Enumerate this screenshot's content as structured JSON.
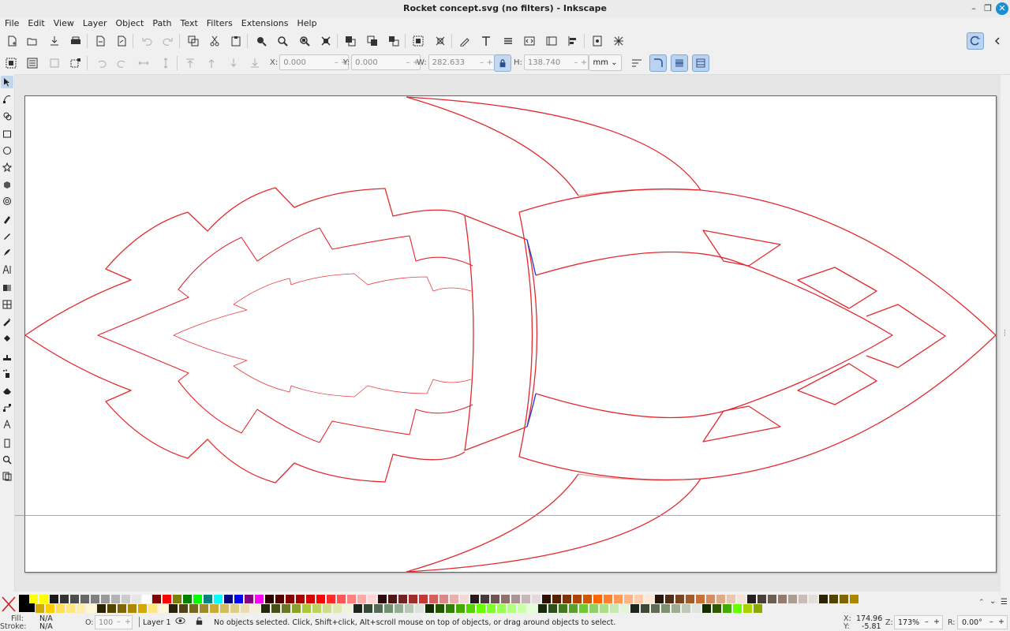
{
  "window": {
    "title": "Rocket concept.svg (no filters) - Inkscape"
  },
  "menu": [
    "File",
    "Edit",
    "View",
    "Layer",
    "Object",
    "Path",
    "Text",
    "Filters",
    "Extensions",
    "Help"
  ],
  "controls": {
    "x_label": "X:",
    "x_value": "0.000",
    "y_label": "Y:",
    "y_value": "0.000",
    "w_label": "W:",
    "w_value": "282.633",
    "h_label": "H:",
    "h_value": "138.740",
    "unit": "mm",
    "minus": "–",
    "plus": "+"
  },
  "status": {
    "fill_label": "Fill:",
    "fill_value": "N/A",
    "stroke_label": "Stroke:",
    "stroke_value": "N/A",
    "opacity_label": "O:",
    "opacity_value": "100",
    "layer": "Layer 1",
    "message": "No objects selected. Click, Shift+click, Alt+scroll mouse on top of objects, or drag around objects to select.",
    "cursor_x_label": "X:",
    "cursor_x": "174.96",
    "cursor_y_label": "Y:",
    "cursor_y": "-5.81",
    "zoom_label": "Z:",
    "zoom": "173%",
    "rotation_label": "R:",
    "rotation": "0.00°"
  },
  "colors": {
    "accent": "#1a8fd4",
    "stroke_red": "#e4282f",
    "stroke_blue": "#2a3fd6"
  }
}
